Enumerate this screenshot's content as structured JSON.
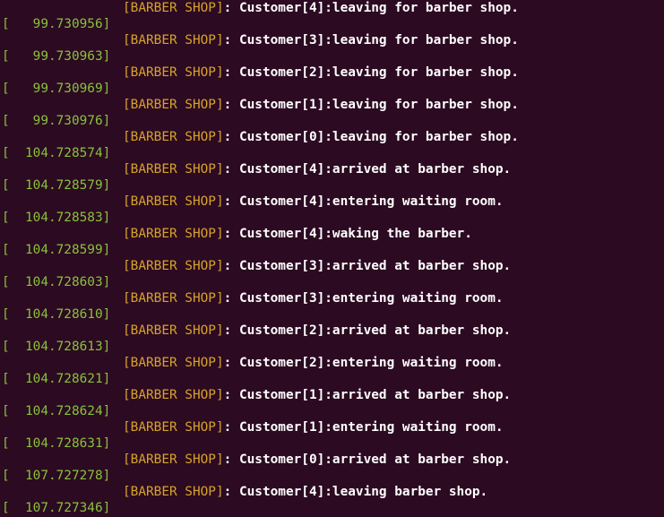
{
  "terminal": {
    "colors": {
      "background": "#2c0a22",
      "tag": "#d6a32a",
      "message": "#ffffff",
      "timestamp": "#89c23a"
    },
    "entries": [
      {
        "ts": "",
        "tag": "[BARBER SHOP]",
        "msg": ": Customer[4]:leaving for barber shop."
      },
      {
        "ts": "[   99.730956]",
        "tag": "[BARBER SHOP]",
        "msg": ": Customer[3]:leaving for barber shop."
      },
      {
        "ts": "[   99.730963]",
        "tag": "[BARBER SHOP]",
        "msg": ": Customer[2]:leaving for barber shop."
      },
      {
        "ts": "[   99.730969]",
        "tag": "[BARBER SHOP]",
        "msg": ": Customer[1]:leaving for barber shop."
      },
      {
        "ts": "[   99.730976]",
        "tag": "[BARBER SHOP]",
        "msg": ": Customer[0]:leaving for barber shop."
      },
      {
        "ts": "[  104.728574]",
        "tag": "[BARBER SHOP]",
        "msg": ": Customer[4]:arrived at barber shop."
      },
      {
        "ts": "[  104.728579]",
        "tag": "[BARBER SHOP]",
        "msg": ": Customer[4]:entering waiting room."
      },
      {
        "ts": "[  104.728583]",
        "tag": "[BARBER SHOP]",
        "msg": ": Customer[4]:waking the barber."
      },
      {
        "ts": "[  104.728599]",
        "tag": "[BARBER SHOP]",
        "msg": ": Customer[3]:arrived at barber shop."
      },
      {
        "ts": "[  104.728603]",
        "tag": "[BARBER SHOP]",
        "msg": ": Customer[3]:entering waiting room."
      },
      {
        "ts": "[  104.728610]",
        "tag": "[BARBER SHOP]",
        "msg": ": Customer[2]:arrived at barber shop."
      },
      {
        "ts": "[  104.728613]",
        "tag": "[BARBER SHOP]",
        "msg": ": Customer[2]:entering waiting room."
      },
      {
        "ts": "[  104.728621]",
        "tag": "[BARBER SHOP]",
        "msg": ": Customer[1]:arrived at barber shop."
      },
      {
        "ts": "[  104.728624]",
        "tag": "[BARBER SHOP]",
        "msg": ": Customer[1]:entering waiting room."
      },
      {
        "ts": "[  104.728631]",
        "tag": "[BARBER SHOP]",
        "msg": ": Customer[0]:arrived at barber shop."
      },
      {
        "ts": "[  107.727278]",
        "tag": "[BARBER SHOP]",
        "msg": ": Customer[4]:leaving barber shop."
      },
      {
        "ts": "[  107.727346]",
        "tag": "",
        "msg": ""
      }
    ]
  }
}
